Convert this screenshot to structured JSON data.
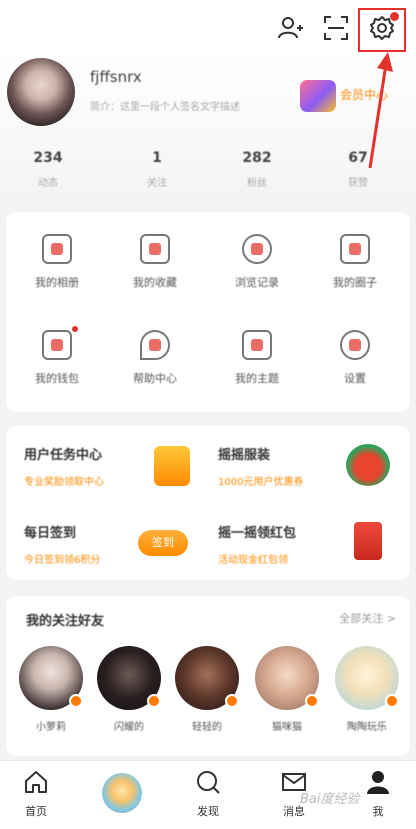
{
  "header": {
    "icons": [
      "add-friend-icon",
      "scan-icon",
      "settings-icon"
    ]
  },
  "profile": {
    "username": "fjffsnrx",
    "bio": "简介：这里一段个人签名文字描述",
    "vip_label": "会员中心"
  },
  "stats": [
    {
      "value": "234",
      "label": "动态"
    },
    {
      "value": "1",
      "label": "关注"
    },
    {
      "value": "282",
      "label": "粉丝"
    },
    {
      "value": "67",
      "label": "获赞"
    }
  ],
  "grid": {
    "items": [
      {
        "label": "我的相册"
      },
      {
        "label": "我的收藏"
      },
      {
        "label": "浏览记录"
      },
      {
        "label": "我的圈子"
      },
      {
        "label": "我的钱包"
      },
      {
        "label": "帮助中心"
      },
      {
        "label": "我的主题"
      },
      {
        "label": "设置"
      }
    ]
  },
  "promos": [
    {
      "title": "用户任务中心",
      "subtitle": "专业奖励领取中心",
      "art": "gift-icon"
    },
    {
      "title": "摇摇服装",
      "subtitle": "1000元用户优惠券",
      "art": "watermelon-icon"
    },
    {
      "title": "每日签到",
      "subtitle": "今日签到领6积分",
      "button": "签到",
      "art": "sign-in-button"
    },
    {
      "title": "摇一摇领红包",
      "subtitle": "活动现金红包领",
      "art": "red-envelope-icon"
    }
  ],
  "friends": {
    "title": "我的关注好友",
    "more": "全部关注 >",
    "items": [
      {
        "name": "小萝莉"
      },
      {
        "name": "闪耀的"
      },
      {
        "name": "轻轻的"
      },
      {
        "name": "猫咪猫"
      },
      {
        "name": "陶陶玩乐"
      }
    ]
  },
  "tabbar": {
    "items": [
      {
        "label": "首页",
        "icon": "home-icon"
      },
      {
        "label": "",
        "icon": "avatar-center"
      },
      {
        "label": "发现",
        "icon": "search-icon"
      },
      {
        "label": "消息",
        "icon": "mail-icon"
      },
      {
        "label": "我",
        "icon": "user-icon"
      }
    ]
  },
  "watermark": "Bai度经验"
}
